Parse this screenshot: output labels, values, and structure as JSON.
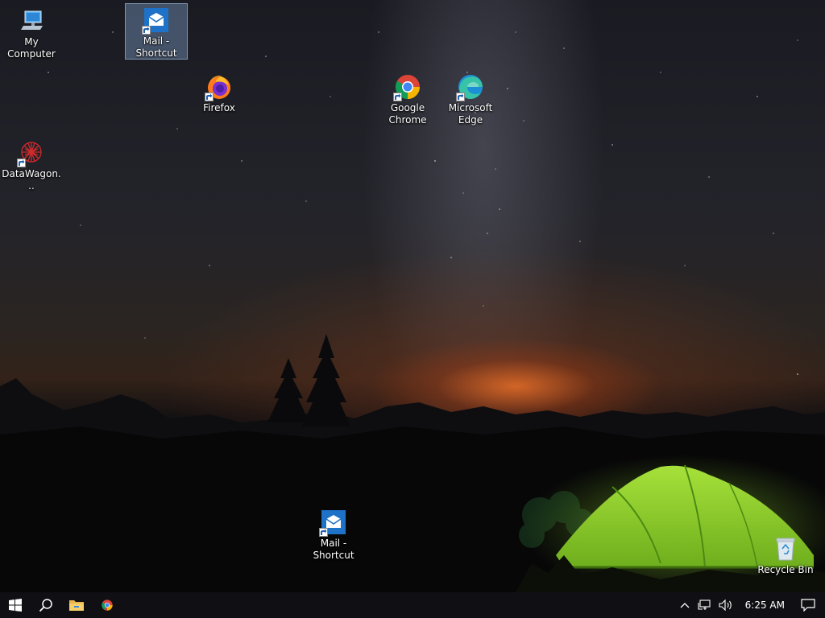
{
  "desktop": {
    "icons": [
      {
        "label": "My Computer",
        "icon": "computer-icon",
        "selected": false
      },
      {
        "label": "Mail - Shortcut",
        "icon": "mail-icon",
        "selected": true
      },
      {
        "label": "Firefox",
        "icon": "firefox-icon",
        "selected": false
      },
      {
        "label": "Google Chrome",
        "icon": "chrome-icon",
        "selected": false
      },
      {
        "label": "Microsoft Edge",
        "icon": "edge-icon",
        "selected": false
      },
      {
        "label": "DataWagon...",
        "icon": "datawagon-icon",
        "selected": false
      },
      {
        "label": "Mail - Shortcut",
        "icon": "mail-icon",
        "selected": false
      },
      {
        "label": "Recycle Bin",
        "icon": "recycle-bin-icon",
        "selected": false
      }
    ]
  },
  "taskbar": {
    "pinned": [
      "start-icon",
      "search-icon",
      "file-explorer-icon",
      "chrome-icon"
    ],
    "tray": {
      "icons": [
        "chevron-up-icon",
        "network-icon",
        "volume-icon"
      ],
      "clock": "6:25 AM",
      "notifications": "action-center-icon"
    }
  },
  "colors": {
    "taskbar": "#101014",
    "tent": "#8fd12a",
    "horizon_glow": "#e86e28",
    "selection": "#7896be"
  }
}
